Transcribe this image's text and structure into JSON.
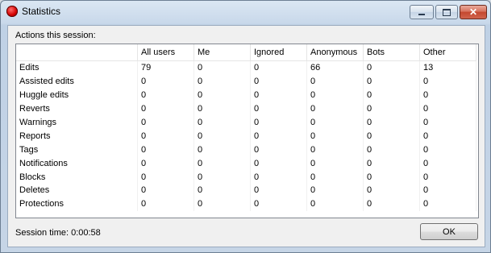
{
  "window": {
    "title": "Statistics"
  },
  "section_label": "Actions this session:",
  "table": {
    "columns": [
      "",
      "All users",
      "Me",
      "Ignored",
      "Anonymous",
      "Bots",
      "Other"
    ],
    "rows": [
      [
        "Edits",
        "79",
        "0",
        "0",
        "66",
        "0",
        "13"
      ],
      [
        "Assisted edits",
        "0",
        "0",
        "0",
        "0",
        "0",
        "0"
      ],
      [
        "Huggle edits",
        "0",
        "0",
        "0",
        "0",
        "0",
        "0"
      ],
      [
        "Reverts",
        "0",
        "0",
        "0",
        "0",
        "0",
        "0"
      ],
      [
        "Warnings",
        "0",
        "0",
        "0",
        "0",
        "0",
        "0"
      ],
      [
        "Reports",
        "0",
        "0",
        "0",
        "0",
        "0",
        "0"
      ],
      [
        "Tags",
        "0",
        "0",
        "0",
        "0",
        "0",
        "0"
      ],
      [
        "Notifications",
        "0",
        "0",
        "0",
        "0",
        "0",
        "0"
      ],
      [
        "Blocks",
        "0",
        "0",
        "0",
        "0",
        "0",
        "0"
      ],
      [
        "Deletes",
        "0",
        "0",
        "0",
        "0",
        "0",
        "0"
      ],
      [
        "Protections",
        "0",
        "0",
        "0",
        "0",
        "0",
        "0"
      ]
    ]
  },
  "session_time": "Session time: 0:00:58",
  "ok_label": "OK",
  "icons": {
    "app": "red-circle-icon",
    "minimize": "minimize-icon",
    "maximize": "maximize-icon",
    "close": "close-icon"
  },
  "colors": {
    "close_button": "#c4472f",
    "app_icon": "#d30000"
  }
}
